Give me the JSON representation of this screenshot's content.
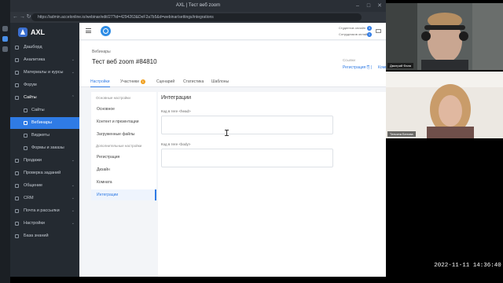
{
  "browser": {
    "tab_title": "AXL | Тест веб zoom",
    "url": "https://admin.accelonline.io/webinar/edit/27?id=4294263&DeF2a7b5&d=webinar/settings/integrations"
  },
  "app": {
    "logo": "AXL",
    "sidebar": [
      {
        "label": "Дашборд"
      },
      {
        "label": "Аналитика",
        "chevron": "⌄"
      },
      {
        "label": "Материалы и курсы",
        "chevron": "⌄"
      },
      {
        "label": "Форум"
      },
      {
        "label": "Сайты",
        "chevron": "⌃"
      },
      {
        "label": "Сайты"
      },
      {
        "label": "Вебинары"
      },
      {
        "label": "Виджеты"
      },
      {
        "label": "Формы и заказы"
      },
      {
        "label": "Продажи",
        "chevron": "⌄"
      },
      {
        "label": "Проверка заданий"
      },
      {
        "label": "Общение",
        "chevron": "⌄"
      },
      {
        "label": "CRM",
        "chevron": "⌄"
      },
      {
        "label": "Почта и рассылки",
        "chevron": "⌄"
      },
      {
        "label": "Настройки",
        "chevron": "⌄"
      },
      {
        "label": "База знаний"
      }
    ]
  },
  "topbar": {
    "students_online": "Студентов онлайн",
    "students_count": "3",
    "staff_online": "Сотрудников онлайн",
    "staff_count": "1"
  },
  "header": {
    "breadcrumb": "Вебинары",
    "title": "Тест веб zoom #84810",
    "links_label": "Ссылки",
    "link_registration": "Регистрация ⎘ |",
    "link_room": "Комната ⎘"
  },
  "tabs": [
    {
      "label": "Настройки"
    },
    {
      "label": "Участники",
      "count": "1"
    },
    {
      "label": "Сценарий"
    },
    {
      "label": "Статистика"
    },
    {
      "label": "Шаблоны"
    }
  ],
  "settings_nav": {
    "basic_head": "Основные настройки",
    "basic": [
      "Основное",
      "Контент и презентации",
      "Загруженные файлы"
    ],
    "extra_head": "Дополнительные настройки",
    "extra": [
      "Регистрация",
      "Дизайн",
      "Комната",
      "Интеграции"
    ]
  },
  "integrations": {
    "title": "Интеграции",
    "head_label": "Код в теге <head>",
    "body_label": "Код в теге <body>"
  },
  "participants": [
    {
      "name": "Дмитрий Фаля"
    },
    {
      "name": "Татьяна Белова"
    }
  ],
  "timestamp": "2022-11-11  14:36:40"
}
